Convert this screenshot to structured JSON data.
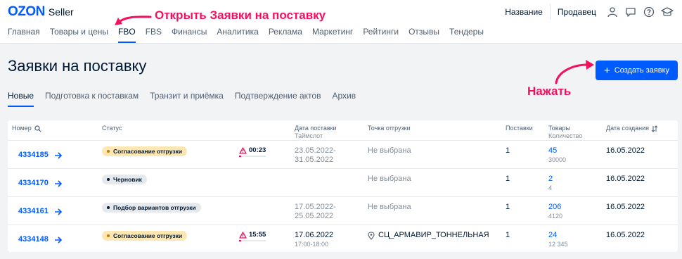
{
  "header": {
    "logo": "OZON",
    "logo_sub": "Seller",
    "right_items": [
      "Название",
      "Продавец"
    ]
  },
  "annotations": {
    "top": "Открыть Заявки на поставку",
    "press": "Нажать"
  },
  "nav": [
    "Главная",
    "Товары и цены",
    "FBO",
    "FBS",
    "Финансы",
    "Аналитика",
    "Реклама",
    "Маркетинг",
    "Рейтинги",
    "Отзывы",
    "Тендеры"
  ],
  "page_title": "Заявки на поставку",
  "create_button": "Создать заявку",
  "tabs": [
    "Новые",
    "Подготовка к поставкам",
    "Транзит и приёмка",
    "Подтверждение актов",
    "Архив"
  ],
  "table": {
    "headers": {
      "number": "Номер",
      "status": "Статус",
      "date": "Дата поставки",
      "date_sub": "Таймслот",
      "point": "Точка отгрузки",
      "supplies": "Поставки",
      "goods": "Товары",
      "goods_sub": "Количество",
      "created": "Дата создания"
    },
    "rows": [
      {
        "number": "4334185",
        "status": "Согласование отгрузки",
        "timer": "00:23",
        "date": "23.05.2022-",
        "date2": "31.05.2022",
        "point": "Не выбрана",
        "supplies": "1",
        "goods": "45",
        "qty": "30000",
        "created": "16.05.2022"
      },
      {
        "number": "4334170",
        "status": "Черновик",
        "timer": "",
        "date": "",
        "date2": "",
        "point": "Не выбрана",
        "supplies": "1",
        "goods": "2",
        "qty": "4",
        "created": "16.05.2022"
      },
      {
        "number": "4334161",
        "status": "Подбор вариантов отгрузки",
        "timer": "",
        "date": "17.05.2022-",
        "date2": "25.05.2022",
        "point": "Не выбрана",
        "supplies": "1",
        "goods": "206",
        "qty": "4120",
        "created": "16.05.2022"
      },
      {
        "number": "4334148",
        "status": "Согласование отгрузки",
        "timer": "15:55",
        "date": "17.06.2022",
        "date2": "17:00-18:00",
        "point": "СЦ_АРМАВИР_ТОННЕЛЬНАЯ",
        "supplies": "1",
        "goods": "24",
        "qty": "12 345",
        "created": "16.05.2022"
      }
    ]
  },
  "colors": {
    "accent": "#005bff",
    "annotation": "#f4115c",
    "badge_yellow": "#ffe7b3",
    "badge_gray": "#e6e9ec"
  }
}
